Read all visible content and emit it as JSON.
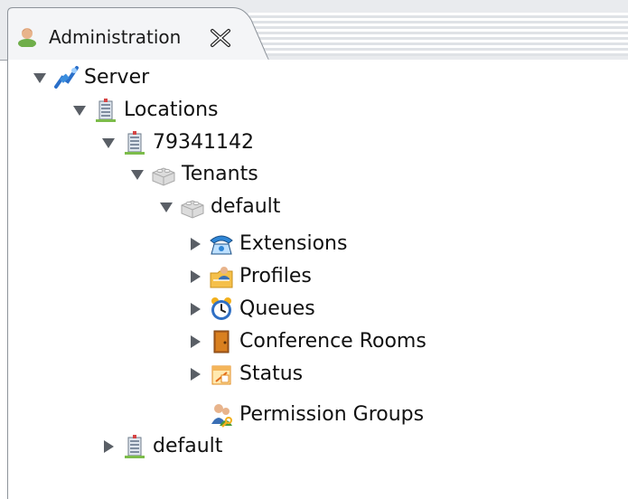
{
  "tab": {
    "title": "Administration",
    "icon": "user-icon",
    "close_icon": "close-icon"
  },
  "tree": {
    "server": {
      "label": "Server",
      "icon": "server-plug-icon",
      "state": "expanded"
    },
    "locations": {
      "label": "Locations",
      "icon": "building-icon",
      "state": "expanded"
    },
    "location_1": {
      "label": "79341142",
      "icon": "building-icon",
      "state": "expanded"
    },
    "tenants": {
      "label": "Tenants",
      "icon": "brick-icon",
      "state": "expanded"
    },
    "tenant_default": {
      "label": "default",
      "icon": "brick-icon",
      "state": "expanded"
    },
    "extensions": {
      "label": "Extensions",
      "icon": "telephone-icon",
      "state": "collapsed"
    },
    "profiles": {
      "label": "Profiles",
      "icon": "profile-folder-icon",
      "state": "collapsed"
    },
    "queues": {
      "label": "Queues",
      "icon": "alarm-clock-icon",
      "state": "collapsed"
    },
    "conference_rooms": {
      "label": "Conference Rooms",
      "icon": "door-icon",
      "state": "collapsed"
    },
    "status": {
      "label": "Status",
      "icon": "status-icon",
      "state": "collapsed"
    },
    "permission_groups": {
      "label": "Permission Groups",
      "icon": "permission-group-icon",
      "state": "leaf"
    },
    "location_default": {
      "label": "default",
      "icon": "building-icon",
      "state": "collapsed"
    }
  },
  "colors": {
    "tab_background": "#f4f5f7",
    "border": "#8d939a",
    "toggle": "#5a5f66"
  }
}
